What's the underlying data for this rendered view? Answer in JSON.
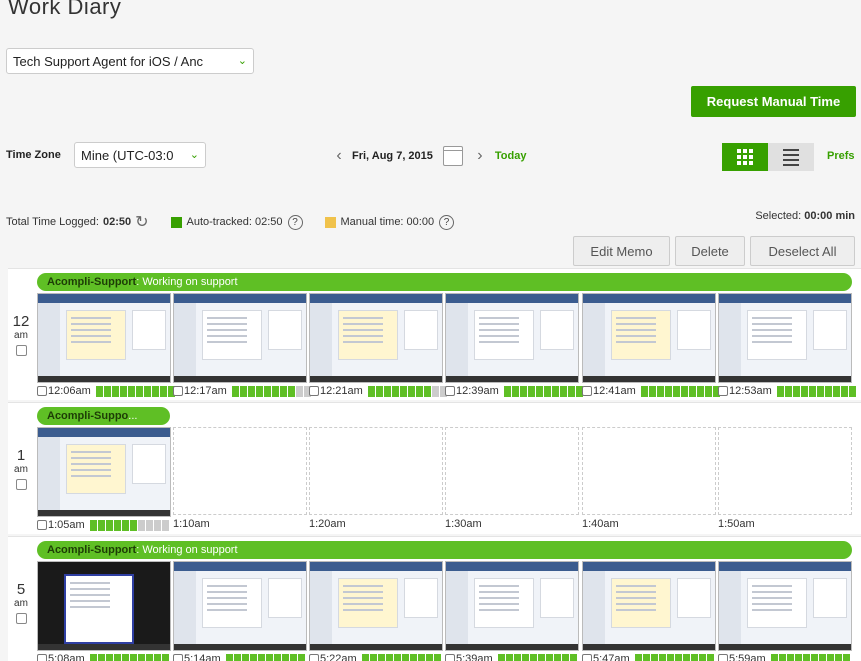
{
  "page": {
    "title": "Work Diary"
  },
  "contract": {
    "value": "Tech Support Agent for iOS / Anc"
  },
  "actions": {
    "request_manual": "Request Manual Time",
    "edit_memo": "Edit Memo",
    "delete": "Delete",
    "deselect_all": "Deselect All"
  },
  "toolbar": {
    "tz_label": "Time Zone",
    "tz_value": "Mine (UTC-03:0",
    "date": "Fri, Aug 7, 2015",
    "today": "Today",
    "prefs": "Prefs"
  },
  "summary": {
    "total_label": "Total Time Logged:",
    "total_value": "02:50",
    "auto_label": "Auto-tracked: 02:50",
    "manual_label": "Manual time: 00:00",
    "selected_label": "Selected:",
    "selected_value": "00:00 min"
  },
  "colors": {
    "accent": "#37a000",
    "memo": "#5fbf25",
    "manual": "#f0c24b"
  },
  "rows": [
    {
      "hour": "12",
      "ampm": "am",
      "memo_app": "Acompli-Support",
      "memo_sep": ": ",
      "memo_text": "Working on support",
      "cells": [
        {
          "time": "12:06am",
          "on": 10
        },
        {
          "time": "12:17am",
          "on": 8
        },
        {
          "time": "12:21am",
          "on": 8
        },
        {
          "time": "12:39am",
          "on": 10
        },
        {
          "time": "12:41am",
          "on": 10
        },
        {
          "time": "12:53am",
          "on": 10
        }
      ]
    },
    {
      "hour": "1",
      "ampm": "am",
      "memo_app": "Acompli-Suppo",
      "memo_sep": "...",
      "memo_text": "",
      "cells": [
        {
          "time": "1:05am",
          "on": 6
        }
      ],
      "empty": [
        "1:10am",
        "1:20am",
        "1:30am",
        "1:40am",
        "1:50am"
      ]
    },
    {
      "hour": "5",
      "ampm": "am",
      "memo_app": "Acompli-Support",
      "memo_sep": ": ",
      "memo_text": "Working on support",
      "cells": [
        {
          "time": "5:08am",
          "on": 10
        },
        {
          "time": "5:14am",
          "on": 10
        },
        {
          "time": "5:22am",
          "on": 10
        },
        {
          "time": "5:39am",
          "on": 10
        },
        {
          "time": "5:47am",
          "on": 10
        },
        {
          "time": "5:59am",
          "on": 10
        }
      ]
    }
  ]
}
